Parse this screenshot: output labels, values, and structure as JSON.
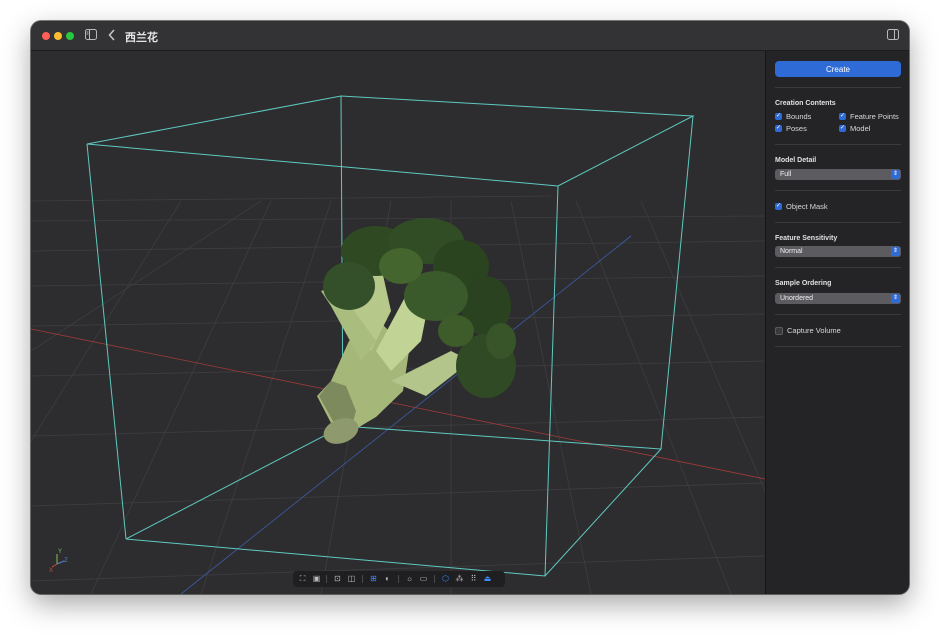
{
  "window": {
    "title": "西兰花",
    "traffic_lights": [
      "#ff5f57",
      "#febc2e",
      "#28c840"
    ],
    "icons": {
      "sidebar_toggle": "sidebar-left-icon",
      "back": "chevron-left-icon",
      "inspector_toggle": "sidebar-right-icon"
    }
  },
  "sidebar": {
    "create_label": "Create",
    "creation_contents": {
      "title": "Creation Contents",
      "items": [
        {
          "label": "Bounds",
          "checked": true
        },
        {
          "label": "Feature Points",
          "checked": true
        },
        {
          "label": "Poses",
          "checked": true
        },
        {
          "label": "Model",
          "checked": true
        }
      ]
    },
    "model_detail": {
      "title": "Model Detail",
      "value": "Full"
    },
    "object_mask": {
      "label": "Object Mask",
      "checked": true
    },
    "feature_sensitivity": {
      "title": "Feature Sensitivity",
      "value": "Normal"
    },
    "sample_ordering": {
      "title": "Sample Ordering",
      "value": "Unordered"
    },
    "capture_volume": {
      "label": "Capture Volume",
      "checked": false
    }
  },
  "viewport": {
    "object": "broccoli",
    "axis_labels": [
      "Y",
      "Z",
      "X"
    ],
    "colors": {
      "bounds": "#5fc9c0",
      "x_axis": "#a33a3a",
      "z_axis": "#3a5ea8"
    }
  },
  "toolbar": {
    "buttons": [
      {
        "icon": "frame-all-icon",
        "active": false
      },
      {
        "icon": "frame-selection-icon",
        "active": false
      },
      {
        "icon": "camera-icon",
        "active": false
      },
      {
        "icon": "images-icon",
        "active": false
      },
      {
        "icon": "grid-icon",
        "active": true
      },
      {
        "icon": "contrast-icon",
        "active": false
      },
      {
        "icon": "light-icon",
        "active": false
      },
      {
        "icon": "rectangle-icon",
        "active": false
      },
      {
        "icon": "bounds-cube-icon",
        "active": true
      },
      {
        "icon": "feature-points-icon",
        "active": false
      },
      {
        "icon": "dots-grid-icon",
        "active": false
      },
      {
        "icon": "camera-poses-icon",
        "active": true
      }
    ]
  }
}
